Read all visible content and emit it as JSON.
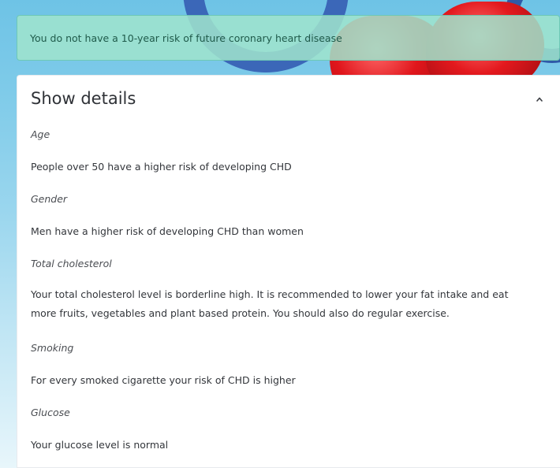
{
  "alert": {
    "message": "You do not have a 10-year risk of future coronary heart disease"
  },
  "details": {
    "title": "Show details",
    "toggle_icon": "chevron-up-icon",
    "sections": [
      {
        "heading": "Age",
        "text": "People over 50 have a higher risk of developing CHD"
      },
      {
        "heading": "Gender",
        "text": "Men have a higher risk of developing CHD than women"
      },
      {
        "heading": "Total cholesterol",
        "text": "Your total cholesterol level is borderline high. It is recommended to lower your fat intake and eat more fruits, vegetables and plant based protein. You should also do regular exercise."
      },
      {
        "heading": "Smoking",
        "text": "For every smoked cigarette your risk of CHD is higher"
      },
      {
        "heading": "Glucose",
        "text": "Your glucose level is normal"
      }
    ]
  }
}
